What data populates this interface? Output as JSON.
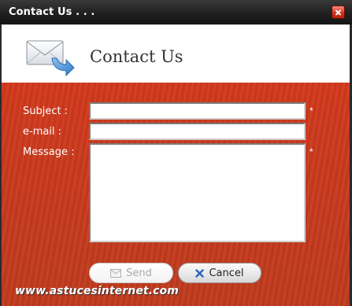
{
  "window": {
    "title": "Contact Us . . ."
  },
  "header": {
    "title": "Contact Us",
    "icon": "mail-reply-icon"
  },
  "form": {
    "subject_label": "Subject :",
    "subject_value": "",
    "email_label": "e-mail :",
    "email_value": "",
    "message_label": "Message :",
    "message_value": "",
    "required_marker": "*"
  },
  "buttons": {
    "send_label": "Send",
    "send_icon": "envelope-icon",
    "cancel_label": "Cancel",
    "cancel_icon": "x-icon"
  },
  "watermark": "www.astucesinternet.com",
  "colors": {
    "form_background": "#c93a1e",
    "title_bar": "#1e1e1e",
    "header_background": "#ffffff"
  }
}
